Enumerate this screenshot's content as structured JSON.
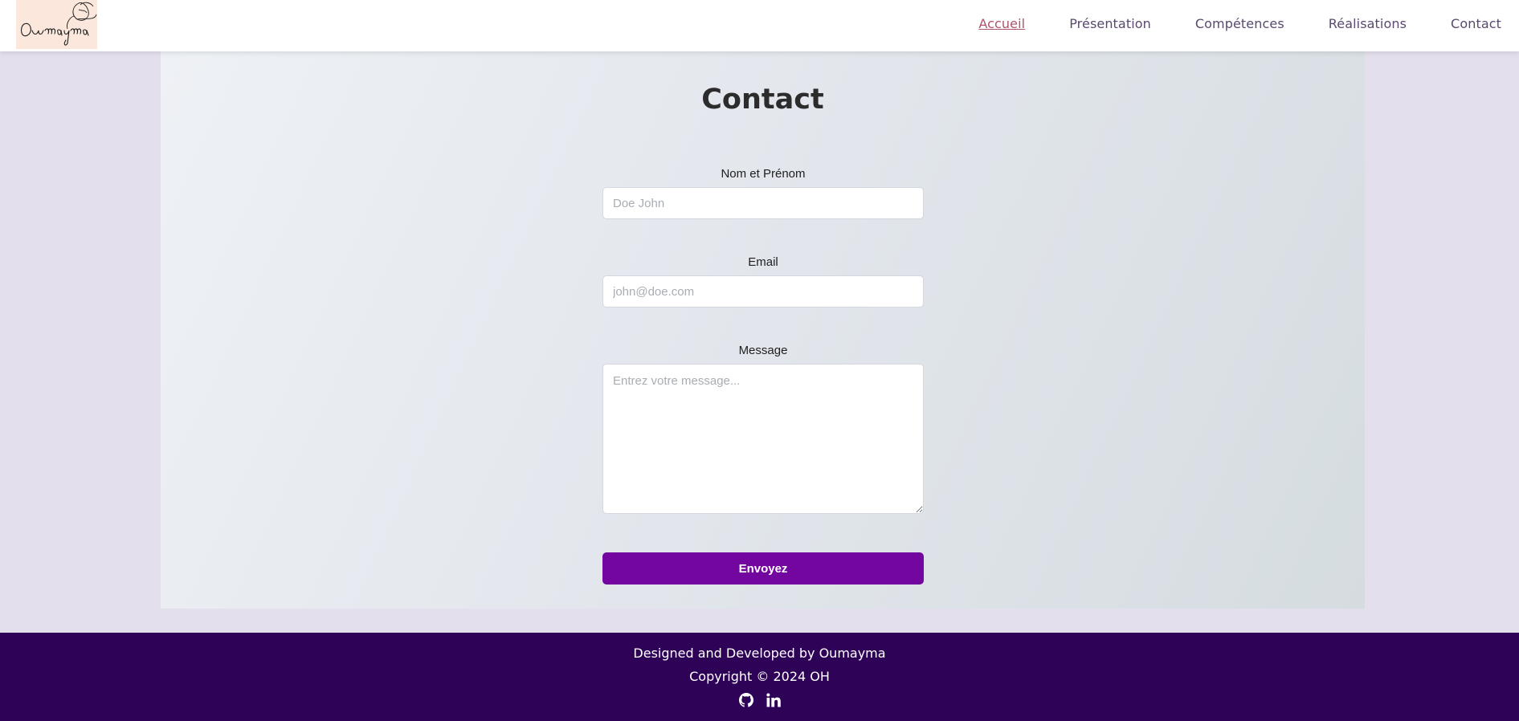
{
  "header": {
    "logo_text": "Oumayma",
    "nav": [
      {
        "label": "Accueil",
        "active": true
      },
      {
        "label": "Présentation",
        "active": false
      },
      {
        "label": "Compétences",
        "active": false
      },
      {
        "label": "Réalisations",
        "active": false
      },
      {
        "label": "Contact",
        "active": false
      }
    ]
  },
  "contact": {
    "title": "Contact",
    "name_label": "Nom et Prénom",
    "name_placeholder": "Doe John",
    "email_label": "Email",
    "email_placeholder": "john@doe.com",
    "message_label": "Message",
    "message_placeholder": "Entrez votre message...",
    "submit_label": "Envoyez"
  },
  "footer": {
    "credit": "Designed and Developed by Oumayma",
    "copyright": "Copyright © 2024 OH",
    "icons": [
      "github-icon",
      "linkedin-icon"
    ]
  },
  "colors": {
    "accent": "#72069e",
    "footer_bg": "#2e0357",
    "active_nav": "#b0536a",
    "page_bg": "#e4dfec"
  }
}
